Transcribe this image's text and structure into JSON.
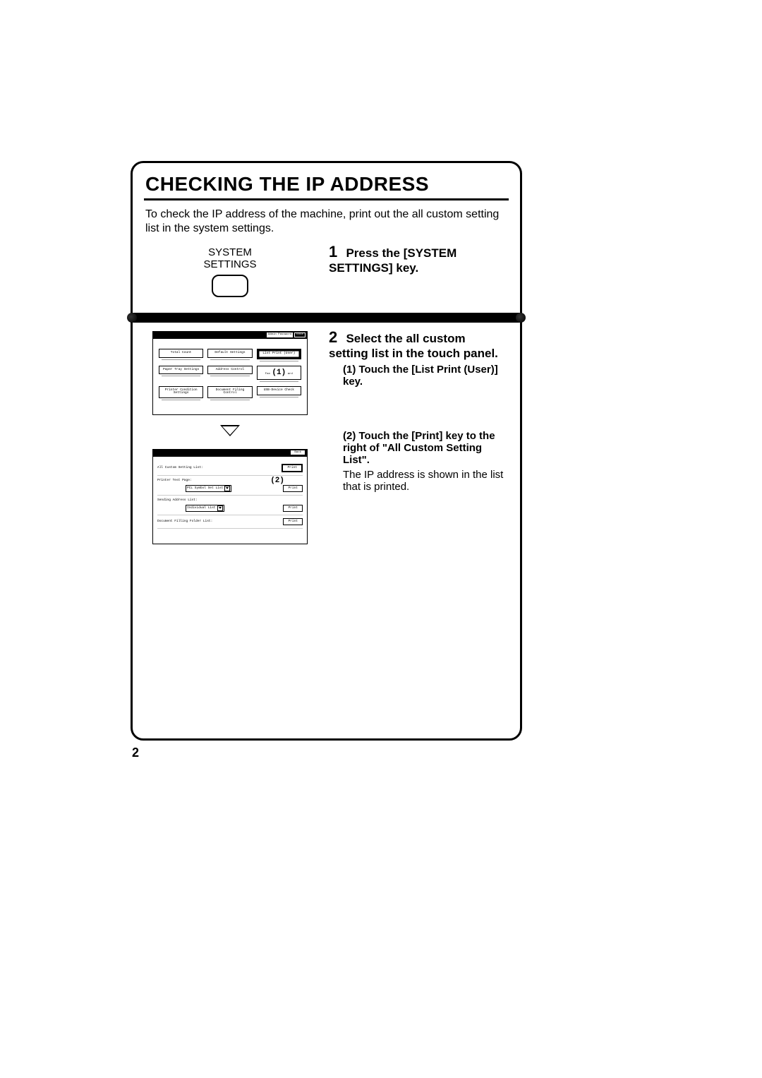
{
  "title": "CHECKING THE IP ADDRESS",
  "intro": "To check the IP address of the machine, print out the all custom setting list in the system settings.",
  "page_number": "2",
  "step1": {
    "num": "1",
    "text": "Press the [SYSTEM SETTINGS] key.",
    "key_label_line1": "SYSTEM",
    "key_label_line2": "SETTINGS"
  },
  "step2": {
    "num": "2",
    "text": "Select the all custom setting list in the touch panel.",
    "sub1": "(1) Touch the [List Print (User)] key.",
    "sub2": "(2) Touch the [Print] key to the right of \"All Custom Setting List\".",
    "note": "The IP address is shown in the list that is printed."
  },
  "screen1": {
    "top_buttons": {
      "admin": "Admin Password",
      "exit": "Exit"
    },
    "buttons": {
      "r1c1": "Total Count",
      "r1c2": "Default Settings",
      "r1c3": "List Print\n(User)",
      "r2c1": "Paper Tray\nSettings",
      "r2c2": "Address Control",
      "r2c3": "Fax Data Receive/Forward",
      "r3c1": "Printer Condition\nSettings",
      "r3c2": "Document Filing\nControl",
      "r3c3": "USB-Device Check"
    },
    "callout": "(1)"
  },
  "screen2": {
    "back": "Back",
    "rows": {
      "r1_label": "All Custom Setting List:",
      "r1_btn": "Print",
      "r2_label": "Printer Test Page:",
      "r2_select": "PCL Symbol Set List",
      "r2_btn": "Print",
      "r3_label": "Sending Address List:",
      "r3_select": "Individual List",
      "r3_btn": "Print",
      "r4_label": "Document Filling Folder List:",
      "r4_btn": "Print"
    },
    "callout": "(2)"
  }
}
